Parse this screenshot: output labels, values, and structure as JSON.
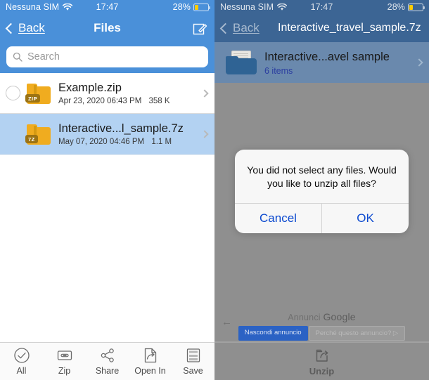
{
  "left": {
    "status": {
      "carrier": "Nessuna SIM",
      "wifi_icon": "wifi-icon",
      "time": "17:47",
      "battery": "28%"
    },
    "nav": {
      "back": "Back",
      "title": "Files",
      "compose_icon": "compose-icon"
    },
    "search": {
      "placeholder": "Search",
      "icon": "search-icon"
    },
    "files": [
      {
        "name": "Example.zip",
        "date": "Apr 23, 2020 06:43 PM",
        "size": "358 K",
        "badge": "ZIP",
        "selected": false
      },
      {
        "name": "Interactive...l_sample.7z",
        "date": "May 07, 2020 04:46 PM",
        "size": "1.1 M",
        "badge": "7Z",
        "selected": true
      }
    ],
    "tabs": [
      {
        "label": "All",
        "icon": "check-circle-icon"
      },
      {
        "label": "Zip",
        "icon": "zip-icon"
      },
      {
        "label": "Share",
        "icon": "share-icon"
      },
      {
        "label": "Open In",
        "icon": "open-in-icon"
      },
      {
        "label": "Save",
        "icon": "save-icon"
      }
    ]
  },
  "right": {
    "status": {
      "carrier": "Nessuna SIM",
      "wifi_icon": "wifi-icon",
      "time": "17:47",
      "battery": "28%"
    },
    "nav": {
      "back": "Back",
      "title": "Interactive_travel_sample.7z"
    },
    "header_row": {
      "name": "Interactive...avel sample",
      "items": "6 items"
    },
    "alert": {
      "message": "You did not select any files. Would you like to unzip all files?",
      "cancel": "Cancel",
      "ok": "OK"
    },
    "ad": {
      "back_icon": "arrow-left-icon",
      "title_prefix": "Annunci",
      "title_brand": "Google",
      "hide": "Nascondi annuncio",
      "why": "Perché questo annuncio? ▷"
    },
    "tabs": [
      {
        "label": "Unzip",
        "icon": "unzip-icon"
      }
    ]
  },
  "colors": {
    "left_nav": "#4a90d9",
    "right_nav": "#3c6594",
    "selected_row": "#b3d2f2",
    "dim_overlay": "#8f8f8f",
    "alert_action": "#0b49cf",
    "folder_yellow": "#f0ac1f",
    "blue_folder": "#2f6394",
    "ad_button_blue": "#2b62c4",
    "battery_yellow": "#ffcc00"
  }
}
